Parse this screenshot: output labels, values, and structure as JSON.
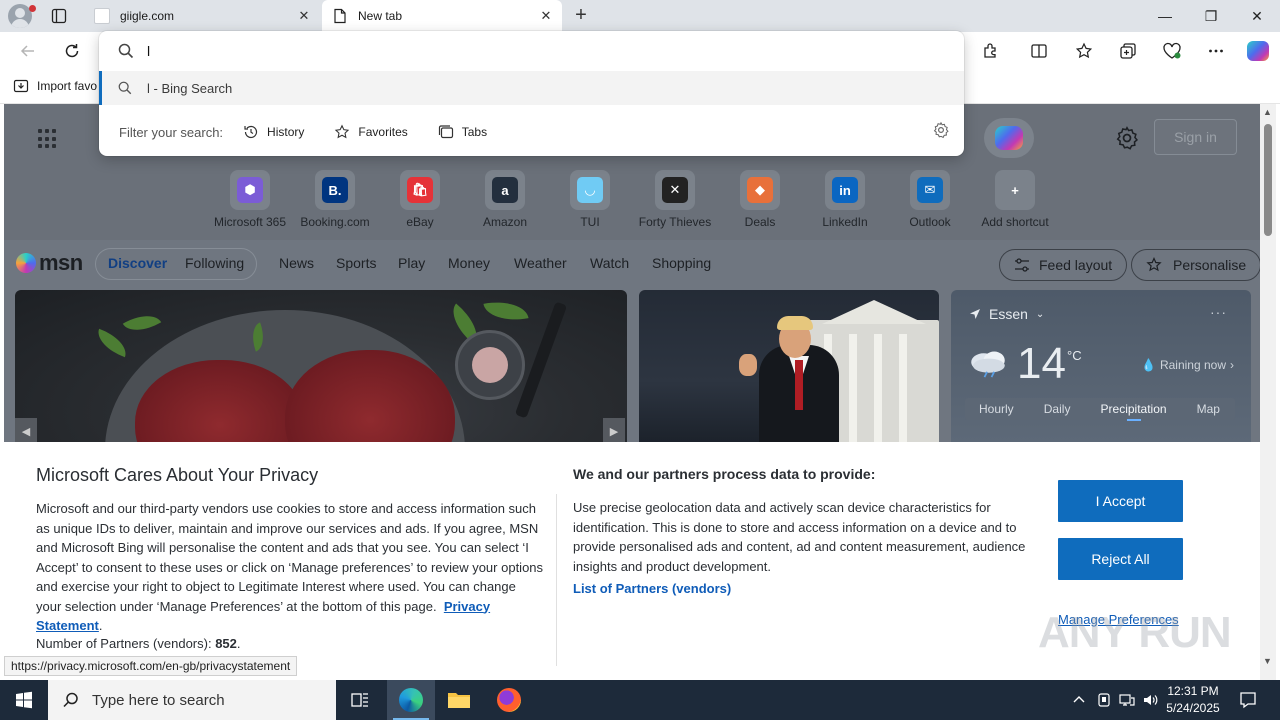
{
  "browser": {
    "tabs": [
      {
        "title": "giigle.com",
        "close": "✕"
      },
      {
        "title": "New tab",
        "close": "✕"
      }
    ],
    "new_tab": "+",
    "window_controls": {
      "minimize": "—",
      "restore": "❐",
      "close": "✕"
    },
    "bookmarks": {
      "import_label": "Import favo"
    }
  },
  "omnibox": {
    "value": "l",
    "suggestion": "l - Bing Search",
    "filter_label": "Filter your search:",
    "filters": [
      "History",
      "Favorites",
      "Tabs"
    ]
  },
  "newtab": {
    "signin": "Sign in",
    "shortcuts": [
      {
        "label": "Microsoft 365",
        "color": "#7b5cd6"
      },
      {
        "label": "Booking.com",
        "color": "#003580"
      },
      {
        "label": "eBay",
        "color": "#e53238"
      },
      {
        "label": "Amazon",
        "color": "#232f3e"
      },
      {
        "label": "TUI",
        "color": "#70cbf4"
      },
      {
        "label": "Forty Thieves",
        "color": "#222222"
      },
      {
        "label": "Deals",
        "color": "#e8703a"
      },
      {
        "label": "LinkedIn",
        "color": "#0a66c2"
      },
      {
        "label": "Outlook",
        "color": "#0f6cbd"
      },
      {
        "label": "Add shortcut",
        "color": "#7b828b"
      }
    ],
    "msn": {
      "brand": "msn",
      "nav": [
        "Discover",
        "Following",
        "News",
        "Sports",
        "Play",
        "Money",
        "Weather",
        "Watch",
        "Shopping"
      ],
      "feed_layout": "Feed layout",
      "personalise": "Personalise"
    },
    "weather": {
      "location": "Essen",
      "temp": "14",
      "unit": "°C",
      "condition": "Raining now",
      "tabs": [
        "Hourly",
        "Daily",
        "Precipitation",
        "Map"
      ],
      "active_tab": "Precipitation"
    }
  },
  "privacy": {
    "title": "Microsoft Cares About Your Privacy",
    "body": "Microsoft and our third-party vendors use cookies to store and access information such as unique IDs to deliver, maintain and improve our services and ads. If you agree, MSN and Microsoft Bing will personalise the content and ads that you see. You can select ‘I Accept’ to consent to these uses or click on ‘Manage preferences’ to review your options and exercise your right to object to Legitimate Interest where used.  You can change your selection under ‘Manage Preferences’ at the bottom of this page.",
    "privacy_link": "Privacy Statement",
    "partners_label": "Number of Partners (vendors):",
    "partners_count": "852",
    "subtitle": "We and our partners process data to provide:",
    "body2": "Use precise geolocation data and actively scan device characteristics for identification. This is done to store and access information on a device and to provide personalised ads and content, ad and content measurement, audience insights and product development.",
    "list_link": "List of Partners (vendors)",
    "accept": "I Accept",
    "reject": "Reject All",
    "manage": "Manage Preferences"
  },
  "status_url": "https://privacy.microsoft.com/en-gb/privacystatement",
  "watermark": "ANY RUN",
  "taskbar": {
    "search_placeholder": "Type here to search",
    "time": "12:31 PM",
    "date": "5/24/2025"
  },
  "colors": {
    "accent": "#0f6cbd",
    "link": "#0f5cb8",
    "taskbar": "#1d2a3a"
  }
}
